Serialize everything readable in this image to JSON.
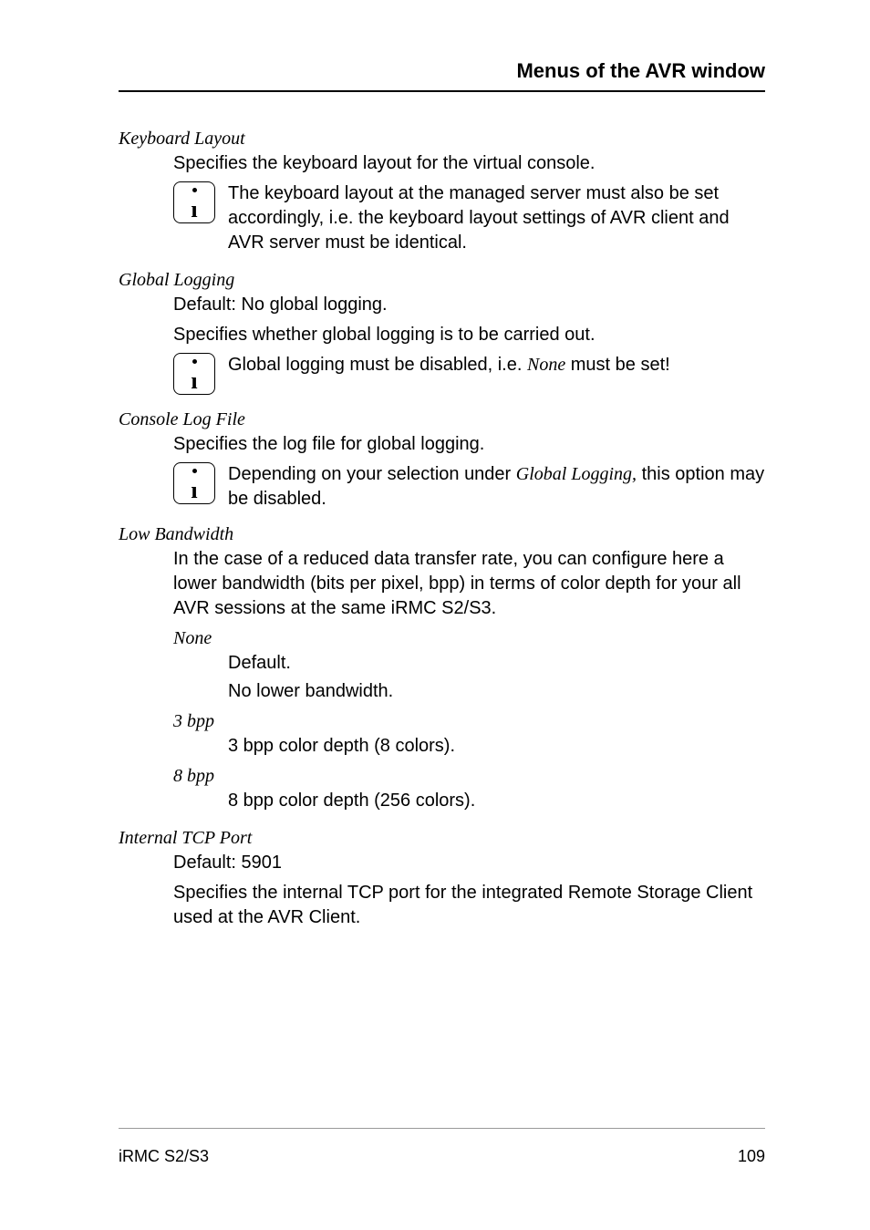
{
  "header": {
    "title": "Menus of the AVR window"
  },
  "sections": {
    "keyboardLayout": {
      "term": "Keyboard Layout",
      "desc": "Specifies the keyboard layout for the virtual console.",
      "info": "The keyboard layout at the managed server must also be set accordingly, i.e. the keyboard layout settings of AVR client and AVR server must be identical."
    },
    "globalLogging": {
      "term": "Global Logging",
      "desc1": "Default: No global logging.",
      "desc2": "Specifies whether global logging is to be carried out.",
      "infoPrefix": "Global logging must be disabled, i.e. ",
      "infoItalic": "None",
      "infoSuffix": " must be set!"
    },
    "consoleLogFile": {
      "term": "Console Log File",
      "desc": "Specifies the log file for global logging.",
      "infoPrefix": "Depending on your selection under ",
      "infoItalic": "Global Logging,",
      "infoSuffix": "  this option may be disabled."
    },
    "lowBandwidth": {
      "term": "Low Bandwidth",
      "desc": "In the case of a reduced data transfer rate, you can configure here a lower bandwidth (bits per pixel, bpp) in terms of color depth for your all AVR sessions at the same iRMC S2/S3.",
      "none": {
        "term": "None",
        "desc1": "Default.",
        "desc2": "No lower bandwidth."
      },
      "bpp3": {
        "term": "3 bpp",
        "desc": "3 bpp color depth (8 colors)."
      },
      "bpp8": {
        "term": "8 bpp",
        "desc": "8 bpp color depth (256 colors)."
      }
    },
    "internalTcpPort": {
      "term": "Internal TCP Port",
      "desc1": "Default: 5901",
      "desc2": "Specifies the internal TCP port for the integrated Remote Storage Client used at the AVR Client."
    }
  },
  "footer": {
    "left": "iRMC S2/S3",
    "right": "109"
  }
}
